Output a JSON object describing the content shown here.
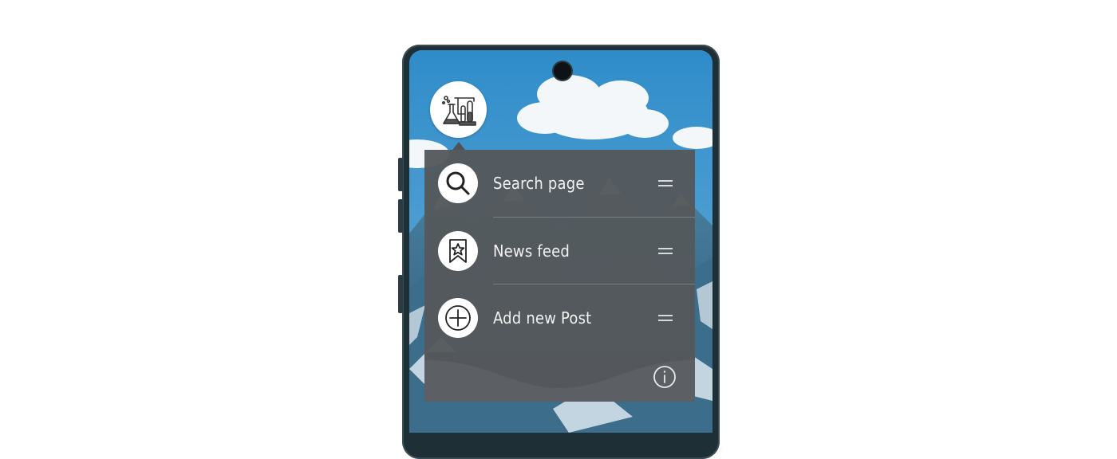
{
  "app": {
    "icon": "lab-flask-icon"
  },
  "shortcuts": [
    {
      "label": "Search page",
      "icon": "search-icon"
    },
    {
      "label": "News feed",
      "icon": "bookmark-star-icon"
    },
    {
      "label": "Add new Post",
      "icon": "add-circle-icon"
    }
  ],
  "footer": {
    "icon": "info-icon"
  },
  "colors": {
    "popup_bg": "#54585c",
    "sky": "#3d8fc5",
    "text": "#f2f2f2"
  }
}
